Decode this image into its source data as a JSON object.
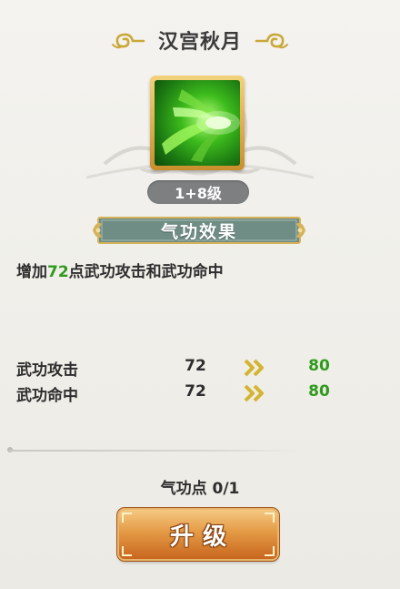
{
  "skill": {
    "title": "汉宫秋月",
    "icon": "green-slash-skill-icon",
    "level_label": "1+8级"
  },
  "effect_banner": {
    "label": "气功效果"
  },
  "description": {
    "prefix": "增加",
    "value": "72",
    "suffix": "点武功攻击和武功命中"
  },
  "stats": [
    {
      "name": "武功攻击",
      "current": "72",
      "next": "80"
    },
    {
      "name": "武功命中",
      "current": "72",
      "next": "80"
    }
  ],
  "points": {
    "text": "气功点 0/1"
  },
  "upgrade_button": {
    "label": "升级"
  },
  "colors": {
    "highlight_green": "#2f9a1c",
    "banner_teal": "#6f8d85",
    "button_orange": "#e49a45",
    "icon_frame_gold": "#d9a94a"
  }
}
